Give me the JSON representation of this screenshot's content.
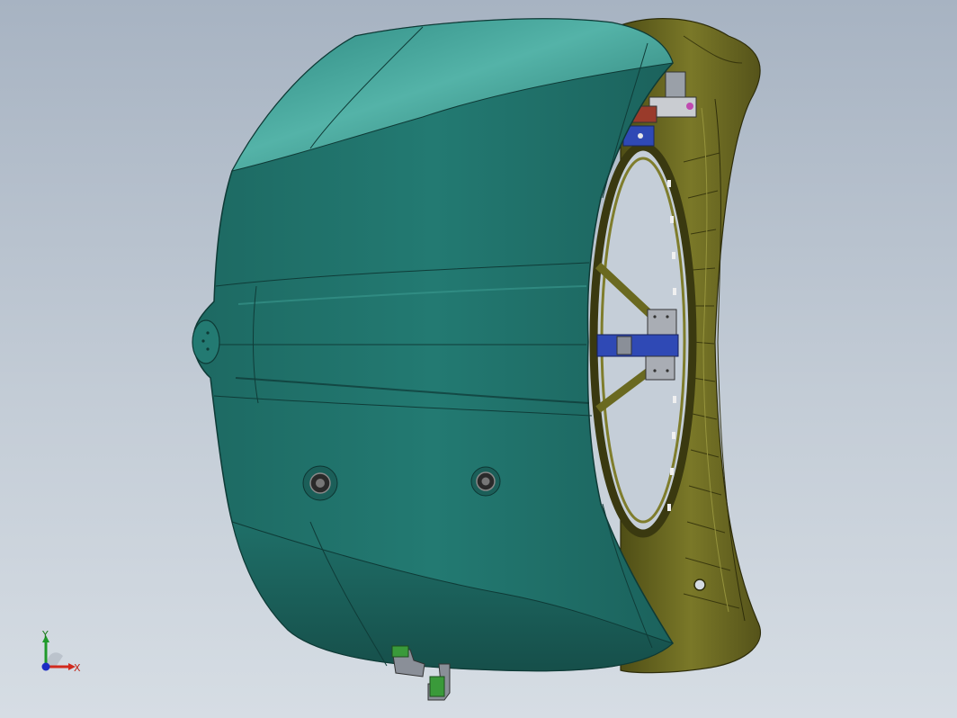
{
  "viewport": {
    "background_top": "#a7b3c2",
    "background_bottom": "#d6dde4"
  },
  "model": {
    "description_icon": "hood-assembly-3d-model",
    "hood_color": "#1f6f68",
    "hood_highlight": "#4aa79d",
    "frame_color": "#6b6a22",
    "fixture_colors": [
      "#2f49b5",
      "#8a8f98",
      "#9a3b2b",
      "#c04ab0",
      "#3a9a3a"
    ]
  },
  "triad": {
    "x_label": "X",
    "y_label": "Y",
    "x_color": "#d12a1e",
    "y_color": "#1f9a2a",
    "z_color": "#1c2cc4"
  }
}
